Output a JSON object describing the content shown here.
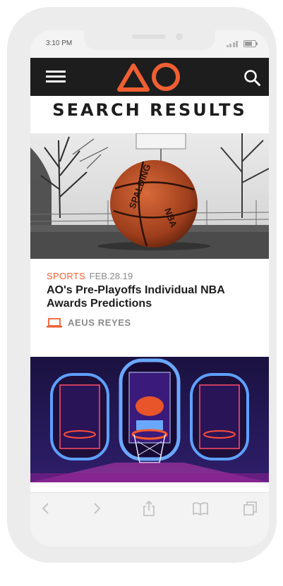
{
  "status_bar": {
    "time": "3:10 PM"
  },
  "header": {
    "logo_text": "AO",
    "colors": {
      "brand": "#ef5f32",
      "bar": "#1d1d1d"
    }
  },
  "page": {
    "title": "SEARCH RESULTS"
  },
  "articles": [
    {
      "category": "SPORTS",
      "date": "FEB.28.19",
      "headline": "AO's Pre-Playoffs Individual NBA Awards Predictions",
      "author": "AEUS REYES",
      "author_icon": "laptop-icon",
      "image": "basketball-on-court-photo"
    },
    {
      "image": "arcade-basketball-machines-photo"
    }
  ],
  "browser_toolbar": {
    "icons": [
      "back-icon",
      "forward-icon",
      "share-icon",
      "bookmarks-icon",
      "tabs-icon"
    ]
  }
}
